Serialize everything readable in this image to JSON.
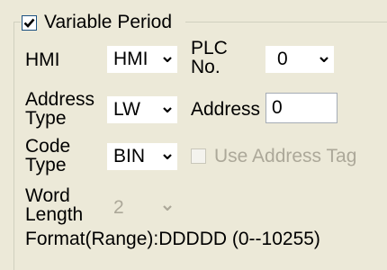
{
  "group": {
    "title": "Variable Period",
    "checked": true
  },
  "hmi": {
    "label": "HMI",
    "value": "HMI"
  },
  "plc_no": {
    "label_line1": "PLC",
    "label_line2": "No.",
    "value": "0"
  },
  "address_type": {
    "label_line1": "Address",
    "label_line2": "Type",
    "value": "LW"
  },
  "address": {
    "label": "Address",
    "value": "0"
  },
  "code_type": {
    "label_line1": "Code",
    "label_line2": "Type",
    "value": "BIN"
  },
  "use_address_tag": {
    "label": "Use Address Tag",
    "checked": false
  },
  "word_length": {
    "label_line1": "Word",
    "label_line2": "Length",
    "value": "2"
  },
  "format": {
    "text": "Format(Range):DDDDD (0--10255)"
  },
  "icons": {
    "dropdown": "chevron-down-icon",
    "check": "check-icon"
  }
}
